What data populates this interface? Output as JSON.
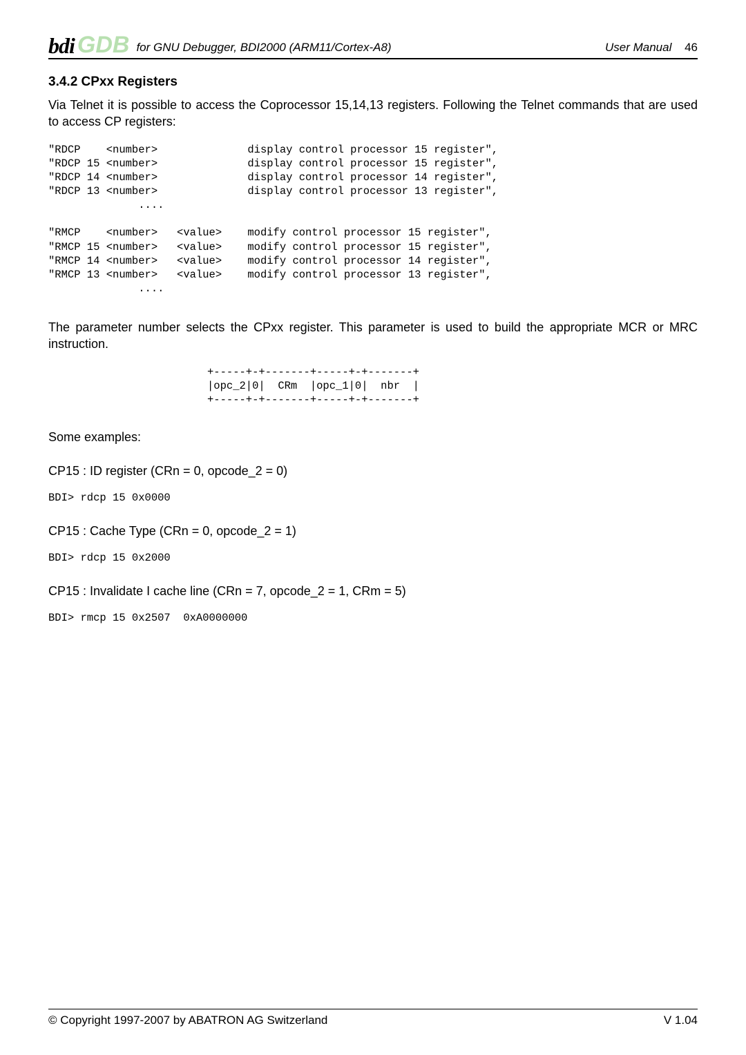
{
  "header": {
    "logo_bdi": "bdi",
    "logo_gdb": "GDB",
    "subtitle": "for GNU Debugger, BDI2000 (ARM11/Cortex-A8)",
    "right_label": "User Manual",
    "page_number": "46"
  },
  "section": {
    "title": "3.4.2 CPxx Registers",
    "intro": "Via Telnet it is possible to access the Coprocessor 15,14,13 registers. Following the Telnet commands that are used to access CP registers:"
  },
  "code_block1": "\"RDCP    <number>              display control processor 15 register\",\n\"RDCP 15 <number>              display control processor 15 register\",\n\"RDCP 14 <number>              display control processor 14 register\",\n\"RDCP 13 <number>              display control processor 13 register\",\n              ....\n\n\"RMCP    <number>   <value>    modify control processor 15 register\",\n\"RMCP 15 <number>   <value>    modify control processor 15 register\",\n\"RMCP 14 <number>   <value>    modify control processor 14 register\",\n\"RMCP 13 <number>   <value>    modify control processor 13 register\",\n              ....",
  "para2": "The parameter number selects the CPxx register. This parameter is used to build the appropriate MCR or MRC instruction.",
  "diagram": "+-----+-+-------+-----+-+-------+\n|opc_2|0|  CRm  |opc_1|0|  nbr  |\n+-----+-+-------+-----+-+-------+",
  "examples_label": "Some examples:",
  "ex1": {
    "title": "CP15 : ID register (CRn = 0, opcode_2 = 0)",
    "cmd": "BDI> rdcp 15 0x0000"
  },
  "ex2": {
    "title": "CP15 : Cache Type (CRn = 0, opcode_2 = 1)",
    "cmd": "BDI> rdcp 15 0x2000"
  },
  "ex3": {
    "title": "CP15 : Invalidate I cache line (CRn = 7, opcode_2 = 1, CRm = 5)",
    "cmd": "BDI> rmcp 15 0x2507  0xA0000000"
  },
  "footer": {
    "left": "© Copyright 1997-2007 by ABATRON AG Switzerland",
    "right": "V 1.04"
  }
}
